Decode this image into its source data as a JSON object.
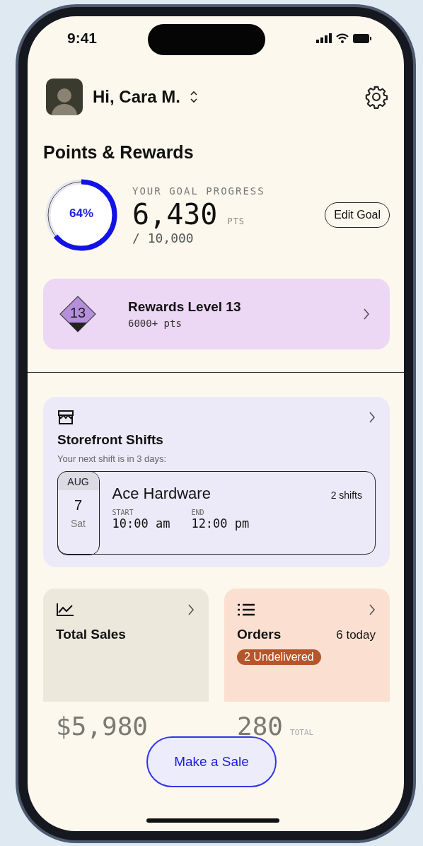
{
  "status_bar": {
    "time": "9:41"
  },
  "header": {
    "greeting": "Hi, Cara M."
  },
  "section_title": "Points & Rewards",
  "goal": {
    "percent": "64%",
    "level": 0.64,
    "label": "YOUR GOAL PROGRESS",
    "points": "6,430",
    "unit": "PTS",
    "target": "/ 10,000",
    "button": "Edit Goal"
  },
  "rewards": {
    "badge": "13",
    "title": "Rewards Level 13",
    "subtitle": "6000+ pts"
  },
  "shifts": {
    "title": "Storefront Shifts",
    "subtitle": "Your next shift is in 3 days:",
    "shift": {
      "month": "AUG",
      "day": "7",
      "weekday": "Sat",
      "store": "Ace Hardware",
      "count": "2 shifts",
      "start_label": "START",
      "start_time": "10:00 am",
      "end_label": "END",
      "end_time": "12:00 pm"
    }
  },
  "stats": [
    {
      "kind": "sales",
      "title": "Total Sales",
      "value": "$5,980"
    },
    {
      "kind": "orders",
      "title": "Orders",
      "count": "6 today",
      "badge": "2 Undelivered",
      "value": "280",
      "unit": "TOTAL"
    }
  ],
  "action_button": "Make a Sale"
}
